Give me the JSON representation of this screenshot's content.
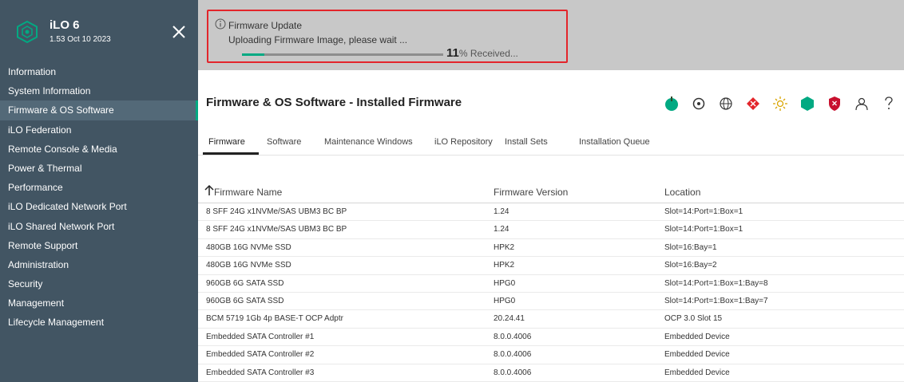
{
  "sidebar": {
    "title": "iLO 6",
    "version": "1.53 Oct 10 2023",
    "items": [
      {
        "label": "Information"
      },
      {
        "label": "System Information"
      },
      {
        "label": "Firmware & OS Software",
        "active": true
      },
      {
        "label": "iLO Federation"
      },
      {
        "label": "Remote Console & Media"
      },
      {
        "label": "Power & Thermal"
      },
      {
        "label": "Performance"
      },
      {
        "label": "iLO Dedicated Network Port"
      },
      {
        "label": "iLO Shared Network Port"
      },
      {
        "label": "Remote Support"
      },
      {
        "label": "Administration"
      },
      {
        "label": "Security"
      },
      {
        "label": "Management"
      },
      {
        "label": "Lifecycle Management"
      }
    ]
  },
  "notification": {
    "title": "Firmware Update",
    "message": "Uploading Firmware Image, please wait ...",
    "progress_percent": 11,
    "progress_number": "11",
    "progress_suffix": "% Received..."
  },
  "main": {
    "title": "Firmware & OS Software - Installed Firmware",
    "tabs": [
      {
        "label": "Firmware",
        "active": true
      },
      {
        "label": "Software"
      },
      {
        "label": "Maintenance Windows"
      },
      {
        "label": "iLO Repository"
      },
      {
        "label": "Install Sets"
      },
      {
        "label": "Installation Queue"
      }
    ],
    "header_icons": [
      "power-icon",
      "uid-locator-icon",
      "globe-icon",
      "health-alert-icon",
      "sun-icon",
      "hexagon-status-icon",
      "shield-icon",
      "user-icon",
      "help-icon"
    ]
  },
  "table": {
    "headers": {
      "name": "Firmware Name",
      "version": "Firmware Version",
      "location": "Location"
    },
    "rows": [
      [
        "8 SFF 24G x1NVMe/SAS UBM3 BC BP",
        "1.24",
        "Slot=14:Port=1:Box=1"
      ],
      [
        "8 SFF 24G x1NVMe/SAS UBM3 BC BP",
        "1.24",
        "Slot=14:Port=1:Box=1"
      ],
      [
        "480GB 16G NVMe SSD",
        "HPK2",
        "Slot=16:Bay=1"
      ],
      [
        "480GB 16G NVMe SSD",
        "HPK2",
        "Slot=16:Bay=2"
      ],
      [
        "960GB 6G SATA SSD",
        "HPG0",
        "Slot=14:Port=1:Box=1:Bay=8"
      ],
      [
        "960GB 6G SATA SSD",
        "HPG0",
        "Slot=14:Port=1:Box=1:Bay=7"
      ],
      [
        "BCM 5719 1Gb 4p BASE-T OCP Adptr",
        "20.24.41",
        "OCP 3.0 Slot 15"
      ],
      [
        "Embedded SATA Controller #1",
        "8.0.0.4006",
        "Embedded Device"
      ],
      [
        "Embedded SATA Controller #2",
        "8.0.0.4006",
        "Embedded Device"
      ],
      [
        "Embedded SATA Controller #3",
        "8.0.0.4006",
        "Embedded Device"
      ]
    ]
  },
  "colors": {
    "sidebar": "#425563",
    "accent": "#01a982",
    "highlight_border": "#e3252b",
    "topbar": "#c8c8c8"
  }
}
